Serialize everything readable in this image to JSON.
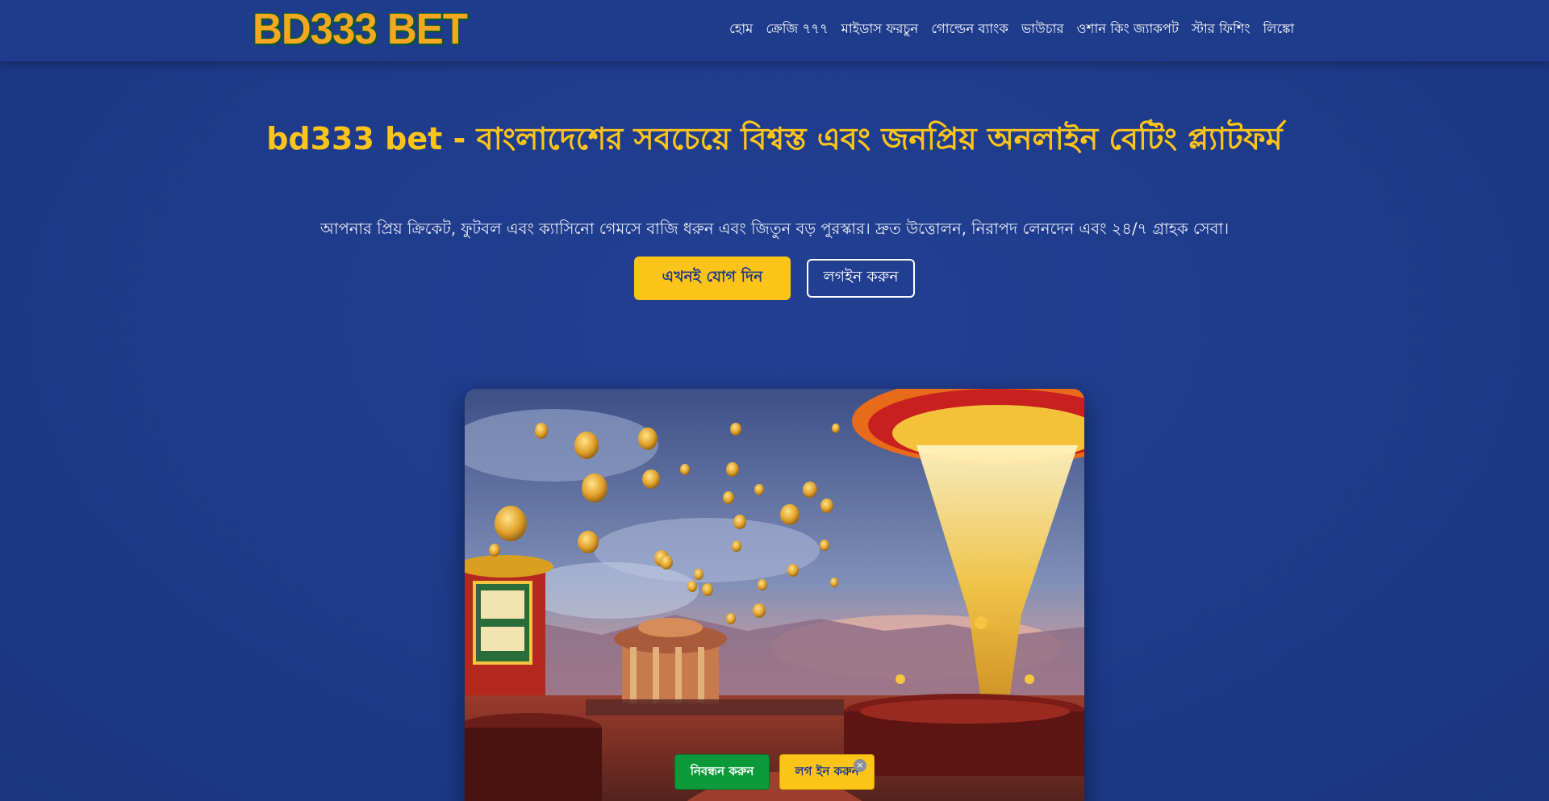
{
  "header": {
    "logo_text": "BD333 BET",
    "nav": [
      "হোম",
      "ক্রেজি ৭৭৭",
      "মাইডাস ফরচুন",
      "গোল্ডেন ব্যাংক",
      "ভাউচার",
      "ওশান কিং জ্যাকপট",
      "স্টার ফিশিং",
      "লিঙ্কো"
    ]
  },
  "hero": {
    "title": "bd333 bet - বাংলাদেশের সবচেয়ে বিশ্বস্ত এবং জনপ্রিয় অনলাইন বেটিং প্ল্যাটফর্ম",
    "subtitle": "আপনার প্রিয় ক্রিকেট, ফুটবল এবং ক্যাসিনো গেমসে বাজি ধরুন এবং জিতুন বড় পুরস্কার। দ্রুত উত্তোলন, নিরাপদ লেনদেন এবং ২৪/৭ গ্রাহক সেবা।",
    "join_button": "এখনই যোগ দিন",
    "login_button": "লগইন করুন",
    "image_icon": "casino-illustration-image"
  },
  "floating_bar": {
    "register_button": "নিবন্ধন করুন",
    "login_button": "লগ ইন করুন",
    "close_icon": "×"
  },
  "colors": {
    "background": "#1e3a8a",
    "accent": "#fcc419",
    "register_green": "#0a9a3a",
    "logo_orange": "#f6a623"
  }
}
